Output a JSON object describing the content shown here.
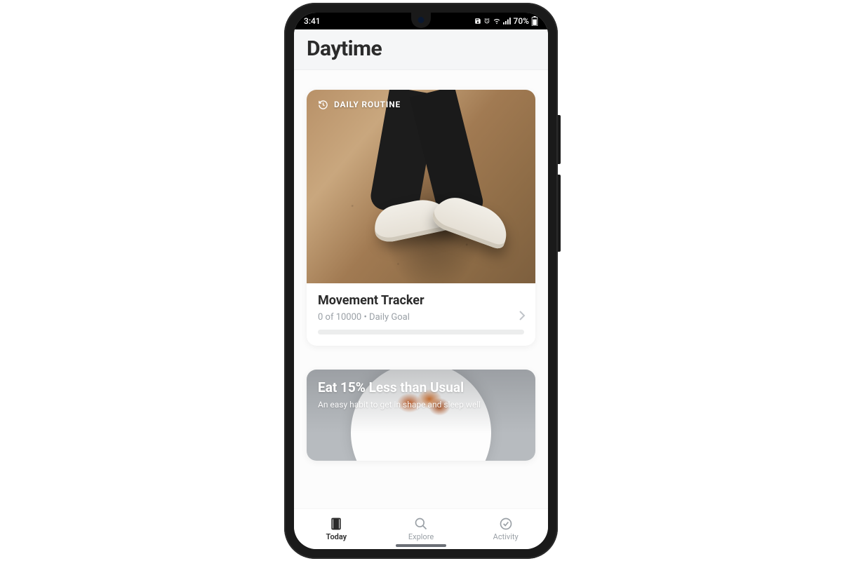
{
  "statusbar": {
    "time": "3:41",
    "battery": "70%"
  },
  "header": {
    "title": "Daytime"
  },
  "routine_card": {
    "tag": "DAILY ROUTINE",
    "title": "Movement Tracker",
    "subtitle": "0 of 10000 • Daily Goal",
    "progress_percent": 0
  },
  "habit_card": {
    "title": "Eat 15% Less than Usual",
    "subtitle": "An easy habit to get in shape and sleep well"
  },
  "tabs": {
    "today": "Today",
    "explore": "Explore",
    "activity": "Activity"
  }
}
